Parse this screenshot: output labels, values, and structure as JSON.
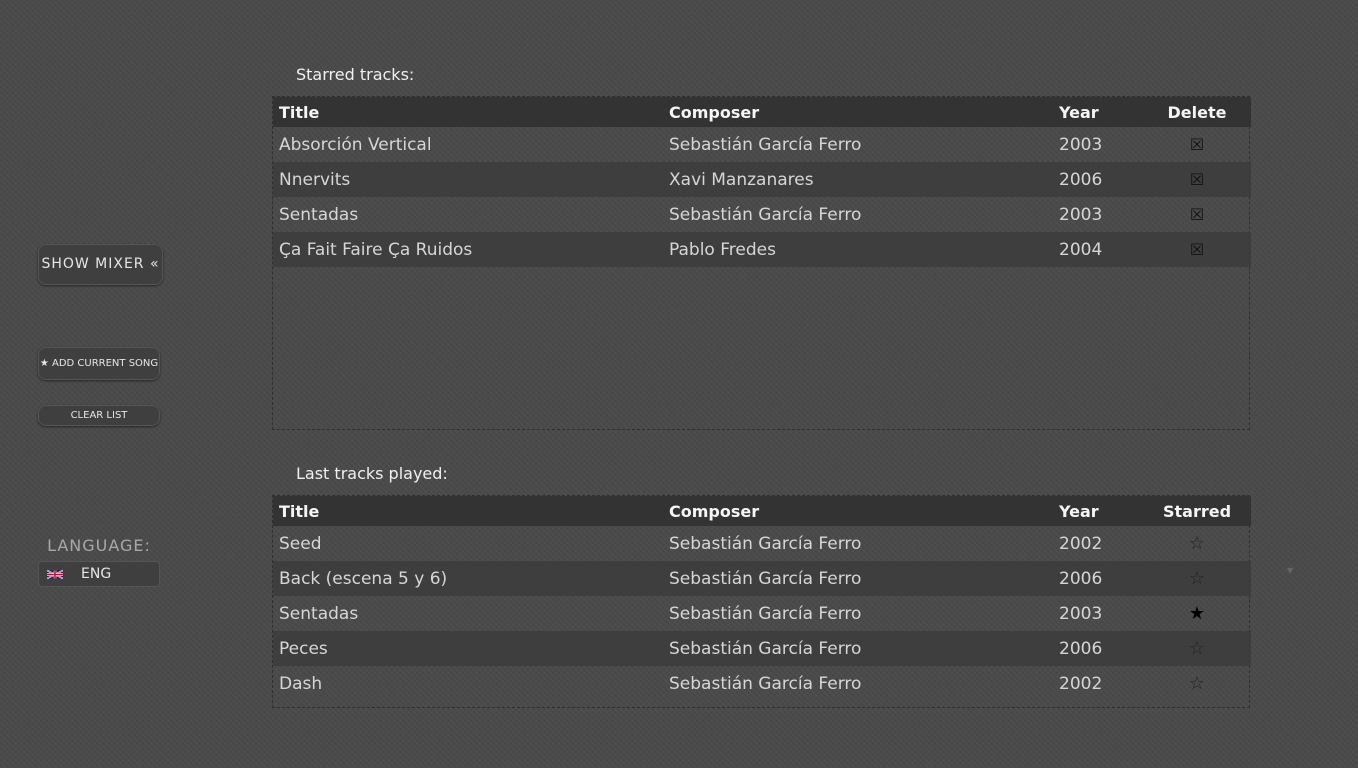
{
  "sidebar": {
    "show_mixer": "SHOW MIXER «",
    "add_current_song": "★ ADD CURRENT SONG",
    "clear_list": "CLEAR LIST",
    "language_label": "LANGUAGE:",
    "language_value": "ENG",
    "flag_icon": "uk-flag-icon"
  },
  "starred": {
    "title": "Starred tracks:",
    "headers": {
      "title": "Title",
      "composer": "Composer",
      "year": "Year",
      "action": "Delete"
    },
    "delete_glyph": "☒",
    "rows": [
      {
        "title": "Absorción Vertical",
        "composer": "Sebastián García Ferro",
        "year": "2003"
      },
      {
        "title": "Nnervits",
        "composer": "Xavi Manzanares",
        "year": "2006"
      },
      {
        "title": "Sentadas",
        "composer": "Sebastián García Ferro",
        "year": "2003"
      },
      {
        "title": "Ça Fait Faire Ça Ruidos",
        "composer": "Pablo Fredes",
        "year": "2004"
      }
    ]
  },
  "last_played": {
    "title": "Last tracks played:",
    "headers": {
      "title": "Title",
      "composer": "Composer",
      "year": "Year",
      "action": "Starred"
    },
    "star_on_glyph": "★",
    "star_off_glyph": "☆",
    "rows": [
      {
        "title": "Seed",
        "composer": "Sebastián García Ferro",
        "year": "2002",
        "starred": false
      },
      {
        "title": "Back (escena 5 y 6)",
        "composer": "Sebastián García Ferro",
        "year": "2006",
        "starred": false
      },
      {
        "title": "Sentadas",
        "composer": "Sebastián García Ferro",
        "year": "2003",
        "starred": true
      },
      {
        "title": "Peces",
        "composer": "Sebastián García Ferro",
        "year": "2006",
        "starred": false
      },
      {
        "title": "Dash",
        "composer": "Sebastián García Ferro",
        "year": "2002",
        "starred": false
      }
    ]
  }
}
